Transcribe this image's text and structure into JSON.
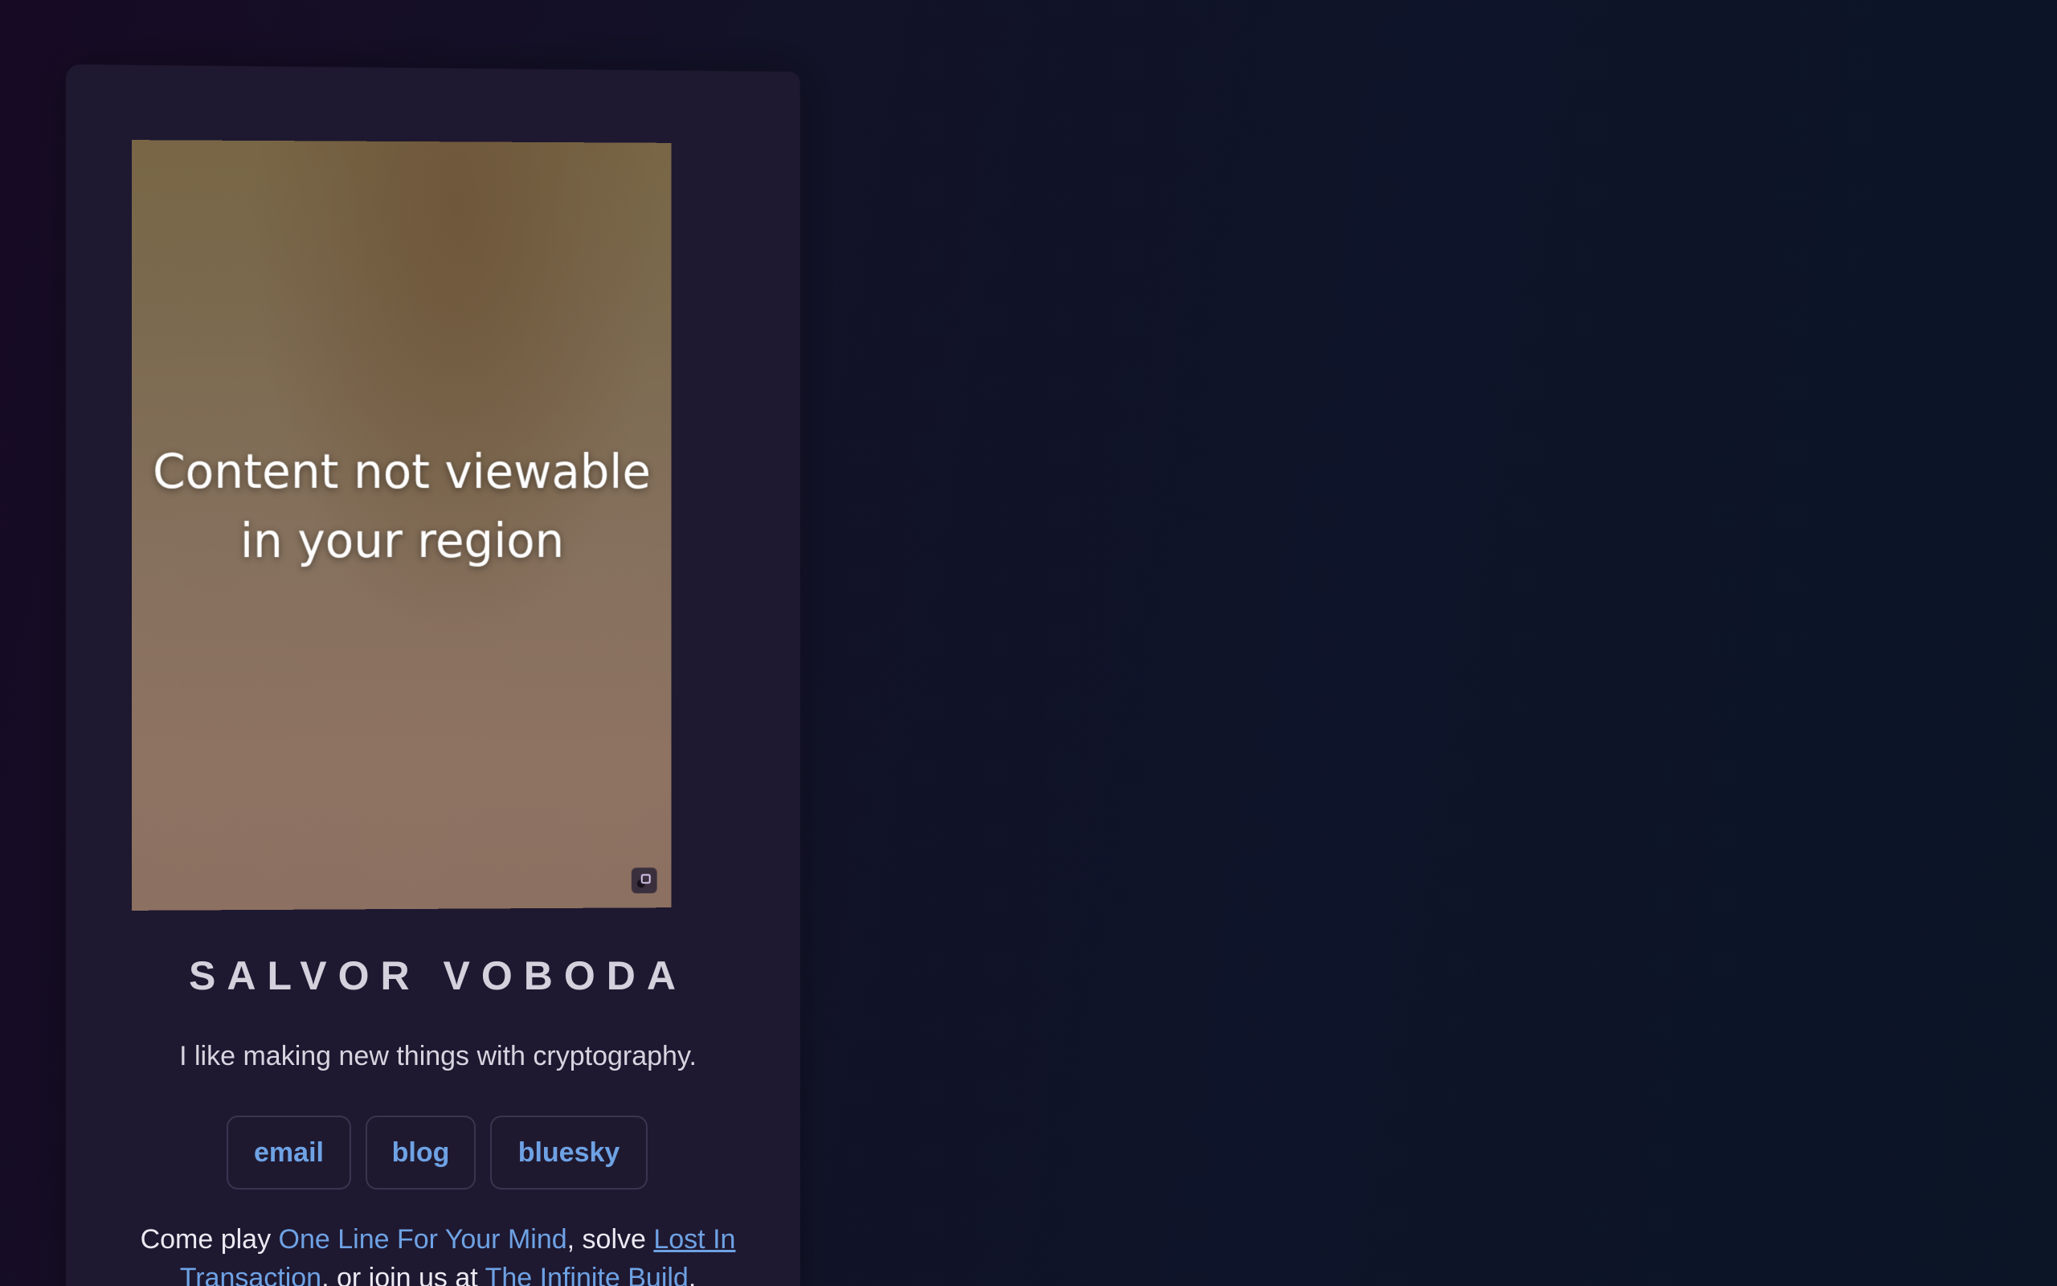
{
  "media": {
    "message_line1": "Content not viewable",
    "message_line2": "in your region",
    "badge_icon": "embed-badge-icon"
  },
  "profile": {
    "name": "SALVOR VOBODA",
    "tagline": "I like making new things with cryptography."
  },
  "links": {
    "email": "email",
    "blog": "blog",
    "bluesky": "bluesky"
  },
  "blurb": {
    "prefix": "Come play ",
    "link1": "One Line For Your Mind",
    "mid1": ", solve ",
    "link2": "Lost In Transaction",
    "mid2": ", or join us at ",
    "link3": "The Infinite Build",
    "suffix": "."
  },
  "colors": {
    "link": "#6ea2e4",
    "card": "#1e1830",
    "background": "#121228"
  }
}
